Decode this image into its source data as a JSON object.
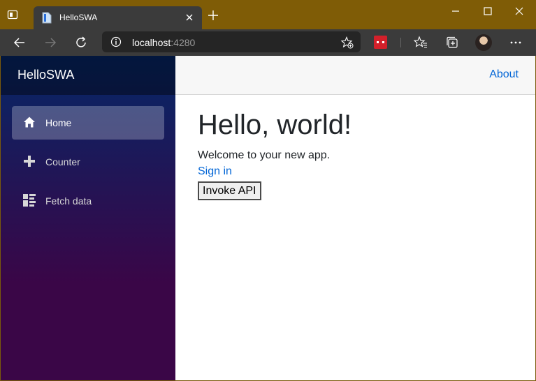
{
  "browser": {
    "tab_title": "HelloSWA",
    "address_host": "localhost",
    "address_port": ":4280"
  },
  "app": {
    "brand": "HelloSWA",
    "top_link": "About",
    "nav": [
      {
        "label": "Home",
        "icon": "home-icon",
        "active": true
      },
      {
        "label": "Counter",
        "icon": "plus-icon",
        "active": false
      },
      {
        "label": "Fetch data",
        "icon": "list-icon",
        "active": false
      }
    ]
  },
  "page": {
    "heading": "Hello, world!",
    "welcome": "Welcome to your new app.",
    "signin_label": "Sign in",
    "invoke_label": "Invoke API"
  },
  "colors": {
    "window_frame": "#7f5c06",
    "link": "#0366d6",
    "sidebar_top": "#052767",
    "sidebar_bottom": "#3a0647",
    "extension": "#d3202a"
  }
}
